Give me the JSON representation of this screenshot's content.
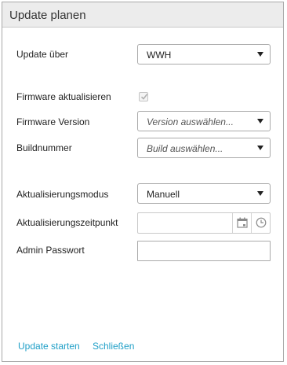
{
  "dialog": {
    "title": "Update planen"
  },
  "form": {
    "update_via": {
      "label": "Update über",
      "value": "WWH"
    },
    "firmware_update": {
      "label": "Firmware aktualisieren",
      "checked": true
    },
    "firmware_version": {
      "label": "Firmware Version",
      "placeholder": "Version auswählen..."
    },
    "build_number": {
      "label": "Buildnummer",
      "placeholder": "Build auswählen..."
    },
    "update_mode": {
      "label": "Aktualisierungsmodus",
      "value": "Manuell"
    },
    "update_time": {
      "label": "Aktualisierungszeitpunkt",
      "value": ""
    },
    "admin_password": {
      "label": "Admin Passwort",
      "value": ""
    }
  },
  "footer": {
    "start_label": "Update starten",
    "close_label": "Schließen"
  },
  "colors": {
    "link": "#1f9fc7",
    "header_bg": "#ececec",
    "border": "#a9a9a9"
  },
  "icons": {
    "calendar": "calendar-icon",
    "clock": "clock-icon",
    "caret": "chevron-down-icon",
    "check": "check-icon"
  }
}
